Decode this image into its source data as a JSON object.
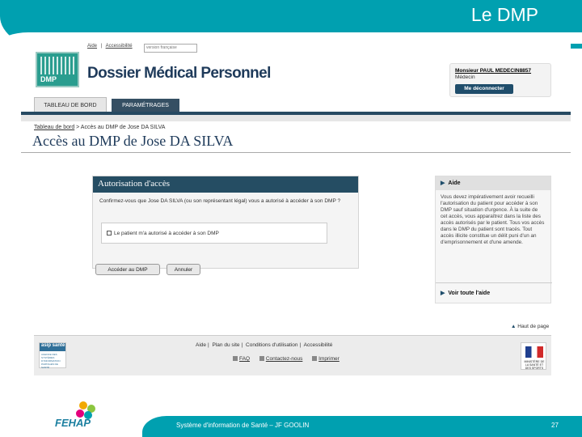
{
  "slide": {
    "title": "Le DMP",
    "footer_text": "Système d'information de Santé – JF GOOLIN",
    "page_number": "27",
    "logo_text": "FEHAP"
  },
  "header": {
    "links": [
      "Aide",
      "|",
      "Accessibilité"
    ],
    "lang_select": "version française",
    "logo_text": "DMP",
    "brand": "Dossier Médical Personnel"
  },
  "user": {
    "name": "Monsieur PAUL MEDECIN8857",
    "role": "Médecin",
    "logout_label": "Me déconnecter"
  },
  "tabs": [
    {
      "label": "TABLEAU DE BORD"
    },
    {
      "label": "PARAMÉTRAGES"
    }
  ],
  "breadcrumb": {
    "home": "Tableau de bord",
    "current": " > Accès au DMP de Jose DA SILVA"
  },
  "page_title": "Accès au DMP de Jose DA SILVA",
  "auth": {
    "title": "Autorisation d'accès",
    "question": "Confirmez-vous que Jose DA SILVA (ou son représentant légal) vous a autorisé à accéder à son DMP ?",
    "checkbox_label": "Le patient m'a autorisé à accéder à son DMP",
    "access_button": "Accéder au DMP",
    "cancel_button": "Annuler"
  },
  "help": {
    "title": "Aide",
    "text": "Vous devez impérativement avoir recueilli l'autorisation du patient pour accéder à son DMP sauf situation d'urgence. À la suite de cet accès, vous apparaîtrez dans la liste des accès autorisés par le patient. Tous vos accès dans le DMP du patient sont tracés. Tout accès illicite constitue un délit puni d'un an d'emprisonnement et d'une amende.",
    "more_link": "Voir toute l'aide"
  },
  "top_link": "Haut de page",
  "footer": {
    "asip_logo": "asip santé",
    "asip_sub": "AGENCE DES SYSTÈMES D'INFORMATION PARTAGÉS DE SANTÉ",
    "links_row1": [
      "Aide",
      "Plan du site",
      "Conditions d'utilisation",
      "Accessibilité"
    ],
    "links_row2": [
      "FAQ",
      "Contactez-nous",
      "Imprimer"
    ],
    "republic_text": "MINISTÈRE DE LA SANTÉ ET DES SPORTS"
  }
}
